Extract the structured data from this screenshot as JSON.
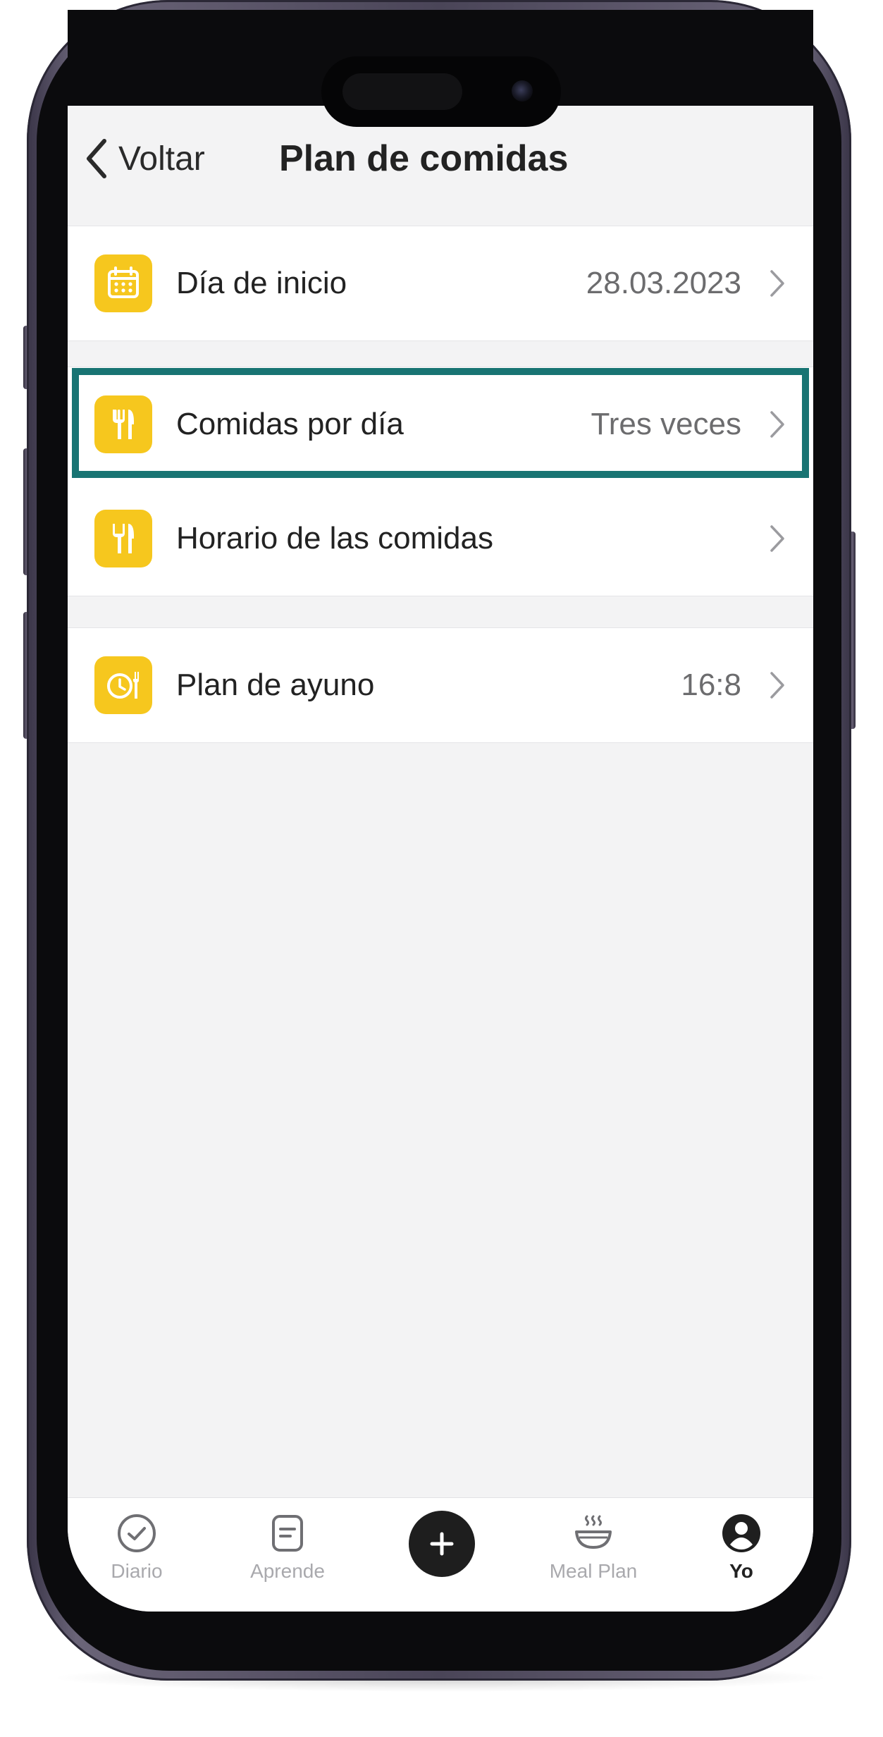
{
  "header": {
    "back_label": "Voltar",
    "title": "Plan de comidas"
  },
  "settings": [
    {
      "label": "Día de inicio",
      "value": "28.03.2023",
      "icon": "calendar-icon"
    },
    {
      "label": "Comidas por día",
      "value": "Tres veces",
      "icon": "cutlery-icon",
      "highlighted": true
    },
    {
      "label": "Horario de las comidas",
      "value": "",
      "icon": "cutlery-icon"
    },
    {
      "label": "Plan de ayuno",
      "value": "16:8",
      "icon": "clock-cutlery-icon"
    }
  ],
  "tabbar": {
    "tabs": [
      {
        "label": "Diario",
        "icon": "check-circle-icon"
      },
      {
        "label": "Aprende",
        "icon": "document-icon"
      },
      {
        "label": "Meal Plan",
        "icon": "bowl-icon"
      },
      {
        "label": "Yo",
        "icon": "profile-icon",
        "active": true
      }
    ],
    "add_icon": "plus-icon"
  },
  "colors": {
    "accent_yellow": "#F6C71E",
    "highlight_teal": "#187473",
    "background": "#F3F3F4",
    "text_primary": "#222222",
    "text_secondary": "#6C6C6E",
    "tab_inactive": "#A9A9AD"
  }
}
